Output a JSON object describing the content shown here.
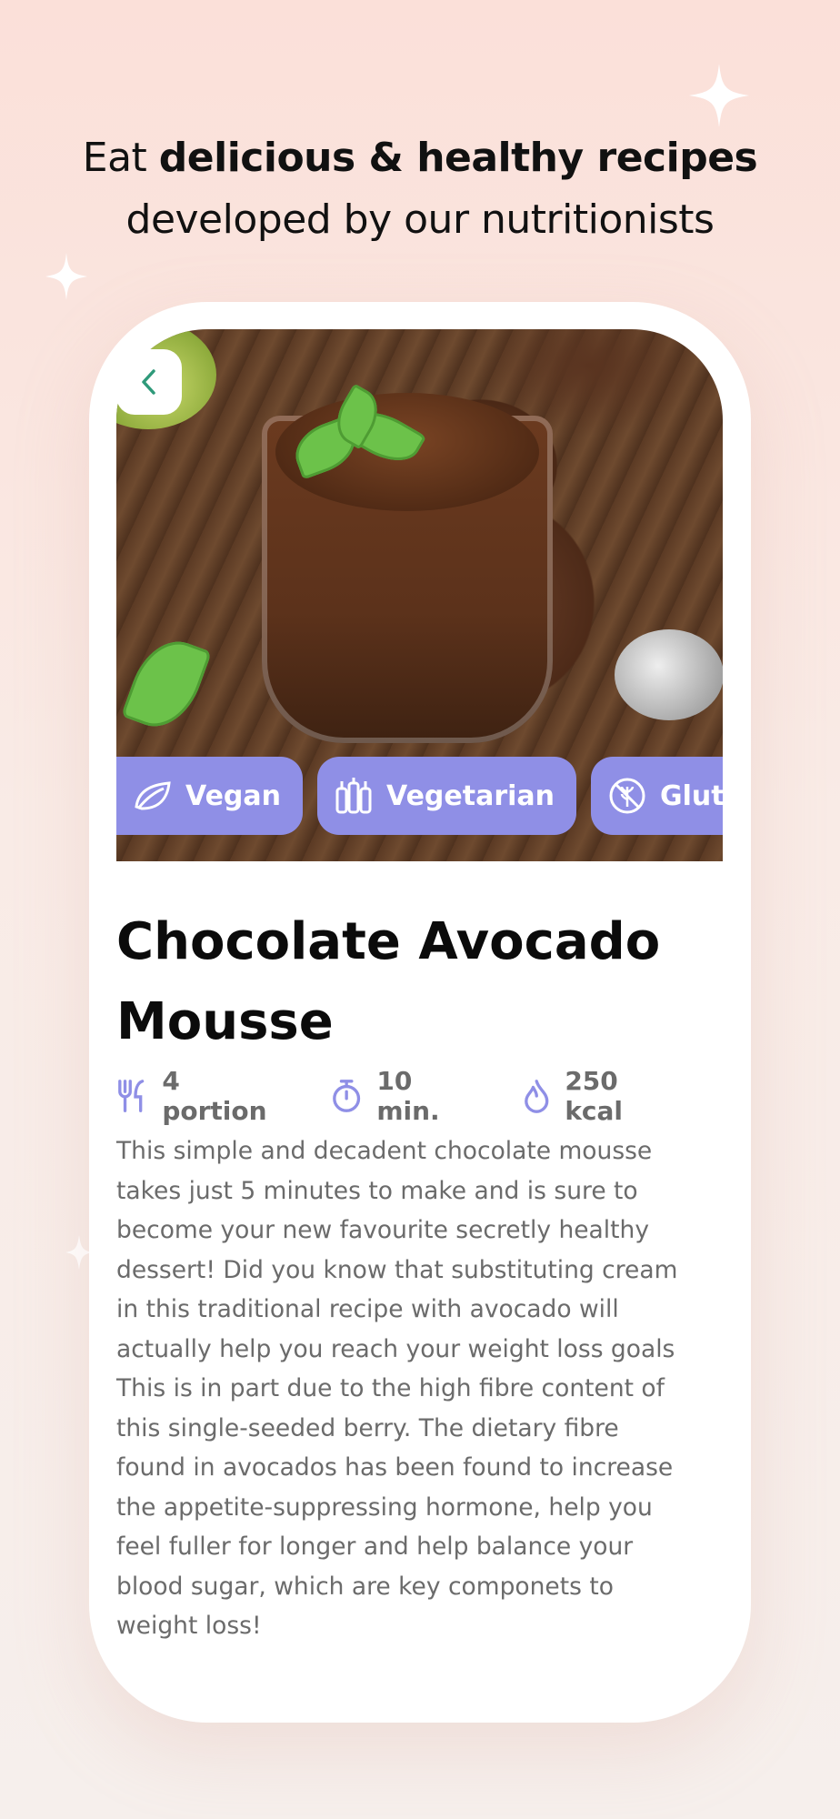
{
  "header": {
    "line1_prefix": "Eat ",
    "line1_bold": "delicious & healthy recipes",
    "line2": "developed by our nutritionists"
  },
  "recipe": {
    "image": "chocolate-avocado-mousse-photo",
    "tags": [
      {
        "label": "Vegan",
        "icon": "leaf-icon"
      },
      {
        "label": "Vegetarian",
        "icon": "vegetables-icon"
      },
      {
        "label": "Gluten",
        "icon": "gluten-free-icon"
      }
    ],
    "title": "Chocolate Avocado Mousse",
    "meta": {
      "portions": "4 portion",
      "time": "10 min.",
      "calories": "250 kcal"
    },
    "description": "This simple and decadent chocolate mousse\ntakes just 5 minutes to make and is sure to\nbecome your new favourite secretly healthy\ndessert! Did you know that substituting cream\nin this traditional recipe with avocado will\nactually help you reach your weight loss goals\nThis is in part due to the high fibre content of\nthis single-seeded berry. The dietary fibre\nfound in avocados has been found to increase\nthe appetite-suppressing hormone, help you\nfeel fuller for longer and help balance your\nblood sugar, which are key componets to\nweight loss!"
  },
  "colors": {
    "accent": "#8f8fe6",
    "back_chevron": "#2f9a7a",
    "text_muted": "#6b6b6b"
  }
}
